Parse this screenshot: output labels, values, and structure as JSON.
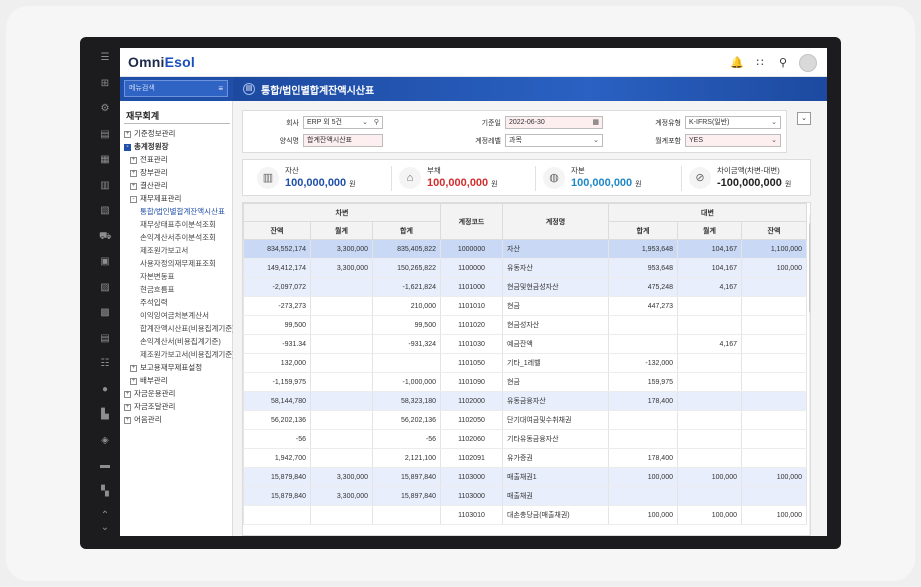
{
  "app": {
    "logo_main": "Omni",
    "logo_accent": "Esol"
  },
  "header_icons": [
    "bell-icon",
    "apps-grid-icon",
    "search-icon",
    "user-avatar"
  ],
  "rail_icons": [
    "menu-icon",
    "network-icon",
    "gear-icon",
    "document-icon",
    "calculator-icon",
    "invoice-icon",
    "report-icon",
    "truck-icon",
    "box-icon",
    "building-icon",
    "archive-icon",
    "ledger-icon",
    "list-icon",
    "person-icon",
    "factory-icon",
    "cube-icon",
    "briefcase-icon",
    "office-icon"
  ],
  "sidebar": {
    "search_placeholder": "메뉴검색",
    "section_title": "재무회계",
    "items": [
      {
        "label": "기준정보관리",
        "box": "+",
        "level": 0,
        "bold": false
      },
      {
        "label": "총계정원장",
        "box": "-",
        "level": 0,
        "bold": true,
        "filled": true
      },
      {
        "label": "전표관리",
        "box": "+",
        "level": 1
      },
      {
        "label": "장부관리",
        "box": "+",
        "level": 1
      },
      {
        "label": "결산관리",
        "box": "+",
        "level": 1
      },
      {
        "label": "재무제표관리",
        "box": "-",
        "level": 1
      },
      {
        "label": "통합/법인별합계잔액시산표",
        "level": 2,
        "active": true
      },
      {
        "label": "재무상태표추이분석조회",
        "level": 2
      },
      {
        "label": "손익계산서추이분석조회",
        "level": 2
      },
      {
        "label": "제조원가보고서",
        "level": 2
      },
      {
        "label": "사용자정의재무제표조회",
        "level": 2
      },
      {
        "label": "자본변동표",
        "level": 2
      },
      {
        "label": "현금흐름표",
        "level": 2
      },
      {
        "label": "주석입력",
        "level": 2
      },
      {
        "label": "이익잉여금처분계산서",
        "level": 2
      },
      {
        "label": "합계잔액시산표(비용집계기준)",
        "level": 2
      },
      {
        "label": "손익계산서(비용집계기준)",
        "level": 2
      },
      {
        "label": "제조원가보고서(비용집계기준)",
        "level": 2
      },
      {
        "label": "보고용재무제표설정",
        "box": "+",
        "level": 1
      },
      {
        "label": "배부관리",
        "box": "+",
        "level": 1
      },
      {
        "label": "자금운용관리",
        "box": "+",
        "level": 0
      },
      {
        "label": "자금조달관리",
        "box": "+",
        "level": 0
      },
      {
        "label": "어음관리",
        "box": "+",
        "level": 0
      }
    ]
  },
  "page": {
    "title": "통합/법인별합계잔액시산표"
  },
  "filters": {
    "company_label": "회사",
    "company_value": "ERP 외 5건",
    "account_name_label": "양식명",
    "account_name_value": "합계잔액시산표",
    "date_label": "기준일",
    "date_value": "2022-06-30",
    "account_level_label": "계정레벨",
    "account_level_value": "과목",
    "account_type_label": "계정유형",
    "account_type_value": "K-IFRS(일반)",
    "include_label": "월계포함",
    "include_value": "YES"
  },
  "summary": [
    {
      "label": "자산",
      "value": "100,000,000",
      "unit": "원",
      "color": "#1f4fa8",
      "icon": "asset-icon"
    },
    {
      "label": "부채",
      "value": "100,000,000",
      "unit": "원",
      "color": "#d12e2e",
      "icon": "liability-icon"
    },
    {
      "label": "자본",
      "value": "100,000,000",
      "unit": "원",
      "color": "#1f88c8",
      "icon": "equity-icon"
    },
    {
      "label": "차이금액(차변-대변)",
      "value": "-100,000,000",
      "unit": "원",
      "color": "#222222",
      "icon": "difference-icon"
    }
  ],
  "grid": {
    "debit_group": "차변",
    "credit_group": "대변",
    "col_code": "계정코드",
    "col_name": "계정명",
    "debit_cols": [
      "잔액",
      "월계",
      "합계"
    ],
    "credit_cols": [
      "합계",
      "월계",
      "잔액"
    ],
    "rows": [
      {
        "d_bal": "834,552,174",
        "d_mon": "3,300,000",
        "d_sum": "835,405,822",
        "code": "1000000",
        "name": "자산",
        "c_sum": "1,953,648",
        "c_mon": "104,167",
        "c_bal": "1,100,000",
        "style": "sel"
      },
      {
        "d_bal": "149,412,174",
        "d_mon": "3,300,000",
        "d_sum": "150,265,822",
        "code": "1100000",
        "name": "유동자산",
        "c_sum": "953,648",
        "c_mon": "104,167",
        "c_bal": "100,000",
        "style": "alt"
      },
      {
        "d_bal": "-2,097,072",
        "d_mon": "",
        "d_sum": "-1,621,824",
        "code": "1101000",
        "name": "현금및현금성자산",
        "c_sum": "475,248",
        "c_mon": "4,167",
        "c_bal": "",
        "style": "alt"
      },
      {
        "d_bal": "-273,273",
        "d_mon": "",
        "d_sum": "210,000",
        "code": "1101010",
        "name": "현금",
        "c_sum": "447,273",
        "c_mon": "",
        "c_bal": "",
        "style": ""
      },
      {
        "d_bal": "99,500",
        "d_mon": "",
        "d_sum": "99,500",
        "code": "1101020",
        "name": "현금성자산",
        "c_sum": "",
        "c_mon": "",
        "c_bal": "",
        "style": ""
      },
      {
        "d_bal": "-931.34",
        "d_mon": "",
        "d_sum": "-931,324",
        "code": "1101030",
        "name": "예금잔액",
        "c_sum": "",
        "c_mon": "4,167",
        "c_bal": "",
        "style": ""
      },
      {
        "d_bal": "132,000",
        "d_mon": "",
        "d_sum": "",
        "code": "1101050",
        "name": "기타_1레벨",
        "c_sum": "-132,000",
        "c_mon": "",
        "c_bal": "",
        "style": ""
      },
      {
        "d_bal": "-1,159,975",
        "d_mon": "",
        "d_sum": "-1,000,000",
        "code": "1101090",
        "name": "현금",
        "c_sum": "159,975",
        "c_mon": "",
        "c_bal": "",
        "style": ""
      },
      {
        "d_bal": "58,144,780",
        "d_mon": "",
        "d_sum": "58,323,180",
        "code": "1102000",
        "name": "유동금융자산",
        "c_sum": "178,400",
        "c_mon": "",
        "c_bal": "",
        "style": "alt"
      },
      {
        "d_bal": "56,202,136",
        "d_mon": "",
        "d_sum": "56,202,136",
        "code": "1102050",
        "name": "단기대여금및수취채권",
        "c_sum": "",
        "c_mon": "",
        "c_bal": "",
        "style": ""
      },
      {
        "d_bal": "-56",
        "d_mon": "",
        "d_sum": "-56",
        "code": "1102060",
        "name": "기타유동금융자산",
        "c_sum": "",
        "c_mon": "",
        "c_bal": "",
        "style": ""
      },
      {
        "d_bal": "1,942,700",
        "d_mon": "",
        "d_sum": "2,121,100",
        "code": "1102091",
        "name": "유가증권",
        "c_sum": "178,400",
        "c_mon": "",
        "c_bal": "",
        "style": ""
      },
      {
        "d_bal": "15,879,840",
        "d_mon": "3,300,000",
        "d_sum": "15,897,840",
        "code": "1103000",
        "name": "매출채권1",
        "c_sum": "100,000",
        "c_mon": "100,000",
        "c_bal": "100,000",
        "style": "alt"
      },
      {
        "d_bal": "15,879,840",
        "d_mon": "3,300,000",
        "d_sum": "15,897,840",
        "code": "1103000",
        "name": "매출채권",
        "c_sum": "",
        "c_mon": "",
        "c_bal": "",
        "style": "alt"
      },
      {
        "d_bal": "",
        "d_mon": "",
        "d_sum": "",
        "code": "1103010",
        "name": "대손충당금(매출채권)",
        "c_sum": "100,000",
        "c_mon": "100,000",
        "c_bal": "100,000",
        "style": ""
      }
    ]
  }
}
